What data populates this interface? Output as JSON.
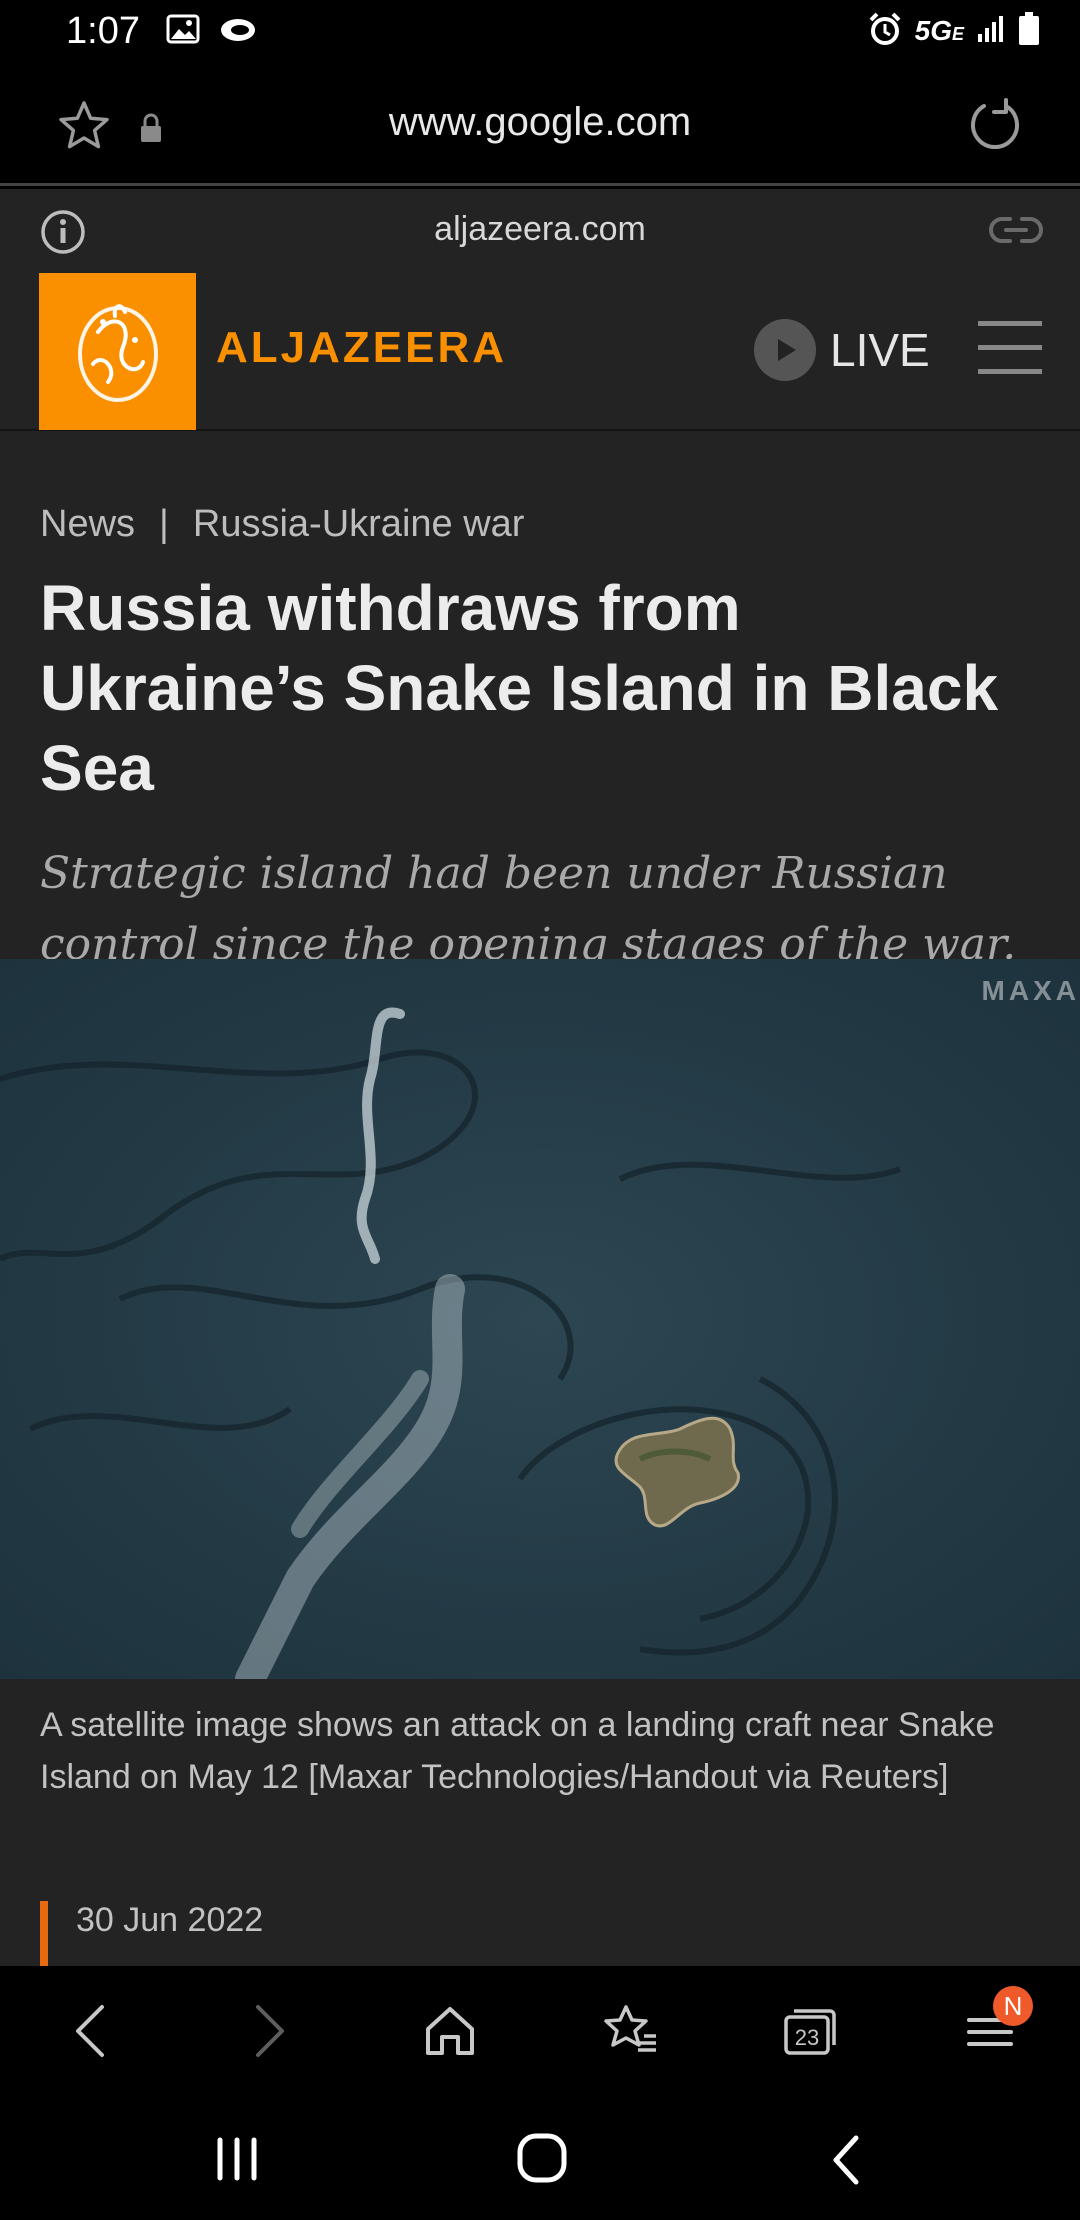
{
  "status_bar": {
    "time": "1:07",
    "network": "5G",
    "network_sub": "E",
    "icons": [
      "gallery-icon",
      "cloud-icon",
      "alarm-icon",
      "signal-icon",
      "battery-icon"
    ]
  },
  "address_bar": {
    "url": "www.google.com",
    "icons": [
      "star-icon",
      "lock-icon",
      "reload-icon"
    ]
  },
  "site_info": {
    "domain": "aljazeera.com",
    "icons": [
      "info-icon",
      "link-icon"
    ]
  },
  "site_header": {
    "brand": "ALJAZEERA",
    "live_label": "LIVE",
    "brand_color": "#fa9000"
  },
  "article": {
    "breadcrumb": [
      "News",
      "Russia-Ukraine war"
    ],
    "breadcrumb_separator": "|",
    "headline": "Russia withdraws from Ukraine’s Snake Island in Black Sea",
    "standfirst": "Strategic island had been under Russian control since the opening stages of the war.",
    "image_watermark": "MAXA",
    "caption": "A satellite image shows an attack on a landing craft near Snake Island on May 12 [Maxar Technologies/Handout via Reuters]",
    "date": "30 Jun 2022",
    "accent_color": "#e86a10"
  },
  "toolbar": {
    "tabs_count": "23",
    "menu_badge": "N",
    "icons": [
      "back-icon",
      "forward-icon",
      "home-icon",
      "bookmarks-icon",
      "tabs-icon",
      "menu-icon"
    ]
  },
  "system_nav": {
    "icons": [
      "recents-icon",
      "home-circle-icon",
      "system-back-icon"
    ]
  }
}
